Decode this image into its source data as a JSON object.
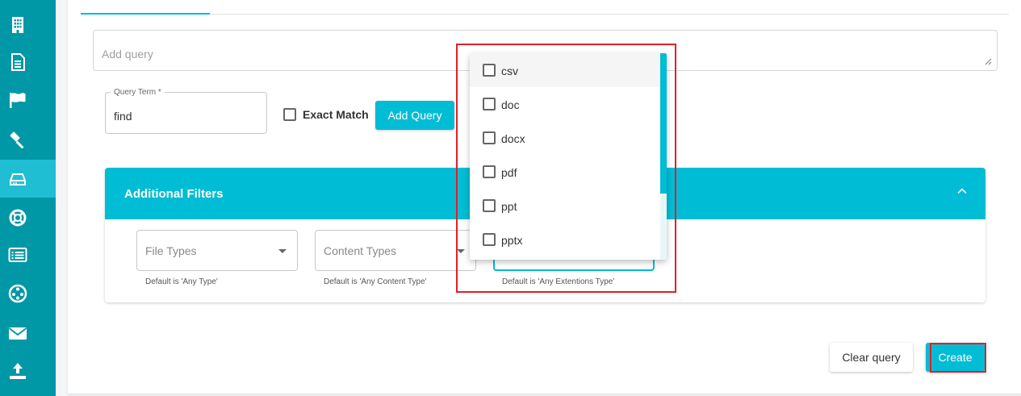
{
  "sidebar": {
    "items": [
      {
        "icon": "building-icon",
        "name": "sidebar-item-building"
      },
      {
        "icon": "document-icon",
        "name": "sidebar-item-documents"
      },
      {
        "icon": "flag-icon",
        "name": "sidebar-item-flags"
      },
      {
        "icon": "gavel-icon",
        "name": "sidebar-item-legal"
      },
      {
        "icon": "drive-icon",
        "name": "sidebar-item-drive",
        "active": true
      },
      {
        "icon": "lifebuoy-icon",
        "name": "sidebar-item-support"
      },
      {
        "icon": "list-icon",
        "name": "sidebar-item-list"
      },
      {
        "icon": "film-reel-icon",
        "name": "sidebar-item-reel"
      },
      {
        "icon": "mail-icon",
        "name": "sidebar-item-mail"
      },
      {
        "icon": "upload-icon",
        "name": "sidebar-item-upload"
      }
    ]
  },
  "query": {
    "placeholder": "Add query",
    "term_label": "Query Term *",
    "term_value": "find",
    "exact_match_label": "Exact Match",
    "exact_match_checked": false,
    "add_query_label": "Add Query"
  },
  "filters": {
    "title": "Additional Filters",
    "file_types": {
      "placeholder": "File Types",
      "helper": "Default is 'Any Type'"
    },
    "content_types": {
      "placeholder": "Content Types",
      "helper": "Default is 'Any Content Type'"
    },
    "extensions": {
      "placeholder": "",
      "helper": "Default is 'Any Extentions Type'"
    }
  },
  "dropdown": {
    "options": [
      {
        "label": "csv",
        "checked": false
      },
      {
        "label": "doc",
        "checked": false
      },
      {
        "label": "docx",
        "checked": false
      },
      {
        "label": "pdf",
        "checked": false
      },
      {
        "label": "ppt",
        "checked": false
      },
      {
        "label": "pptx",
        "checked": false
      }
    ]
  },
  "actions": {
    "clear_label": "Clear query",
    "create_label": "Create"
  },
  "colors": {
    "sidebar": "#0098a6",
    "accent": "#00bcd4",
    "highlight": "#e0202a"
  }
}
